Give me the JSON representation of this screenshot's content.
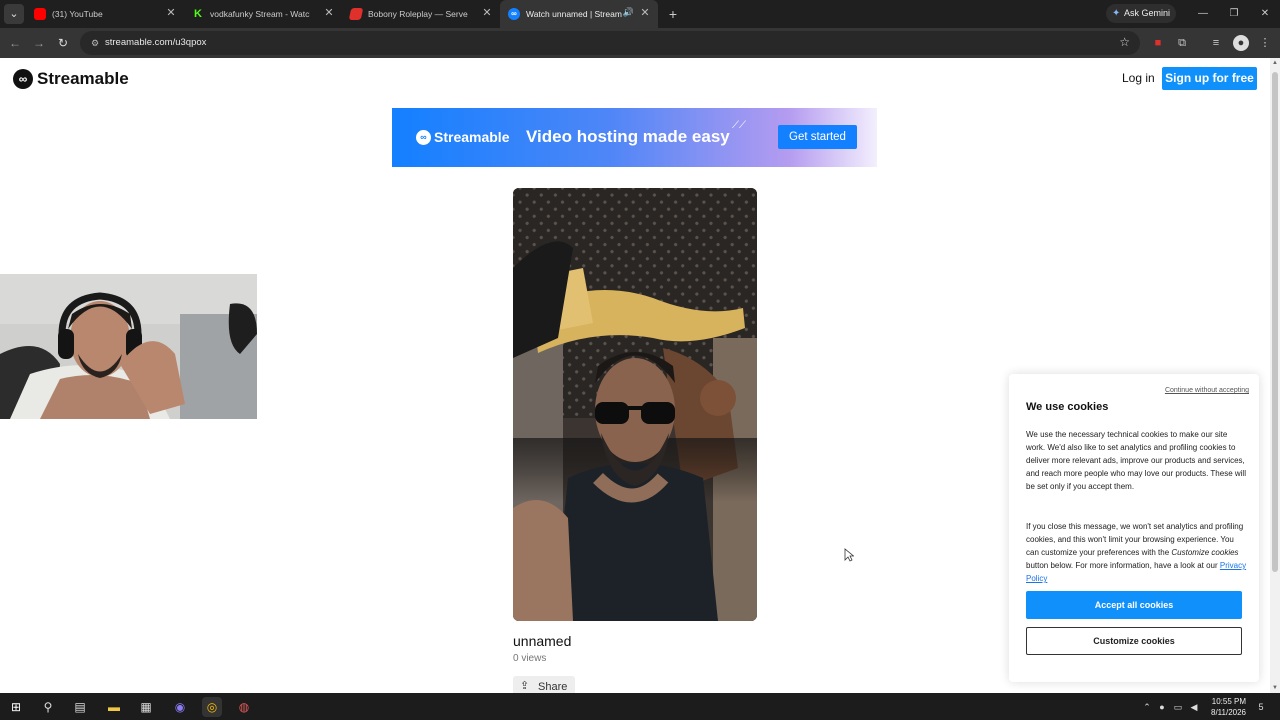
{
  "browser": {
    "tabs": [
      {
        "title": "(31) YouTube",
        "favicon_color": "#ff0000"
      },
      {
        "title": "vodkafunky Stream - Watch Live",
        "favicon_color": "#53fc18"
      },
      {
        "title": "Bobony Roleplay — Serveur GTA",
        "favicon_color": "#e0302b"
      },
      {
        "title": "Watch unnamed | Streamable",
        "favicon_color": "#1380ff"
      }
    ],
    "new_tab": "+",
    "ask_gemini": "Ask Gemini",
    "url": "streamable.com/u3qpox"
  },
  "header": {
    "logo_text": "Streamable",
    "login": "Log in",
    "signup": "Sign up for free"
  },
  "banner": {
    "brand": "Streamable",
    "tagline": "Video hosting made easy",
    "cta": "Get started"
  },
  "video": {
    "title": "unnamed",
    "views": "0 views",
    "share": "Share"
  },
  "cookie": {
    "continue": "Continue without accepting",
    "heading": "We use cookies",
    "p1": "We use the necessary technical cookies to make our site work. We'd also like to set analytics and profiling cookies to deliver more relevant ads, improve our products and services, and reach more people who may love our products. These will be set only if you accept them.",
    "p2_a": "If you close this message, we won't set analytics and profiling cookies, and this won't limit your browsing experience. You can customize your preferences with the ",
    "p2_em": "Customize cookies",
    "p2_b": " button below. For more information, have a look at our ",
    "privacy": "Privacy Policy",
    "accept": "Accept all cookies",
    "customize": "Customize cookies"
  },
  "taskbar": {
    "time": "10:55 PM",
    "date": "8/11/2026",
    "notification_count": "5"
  },
  "colors": {
    "brand_blue": "#0f90fa",
    "chrome_dark": "#1f1f1f",
    "chrome_mid": "#353535"
  }
}
